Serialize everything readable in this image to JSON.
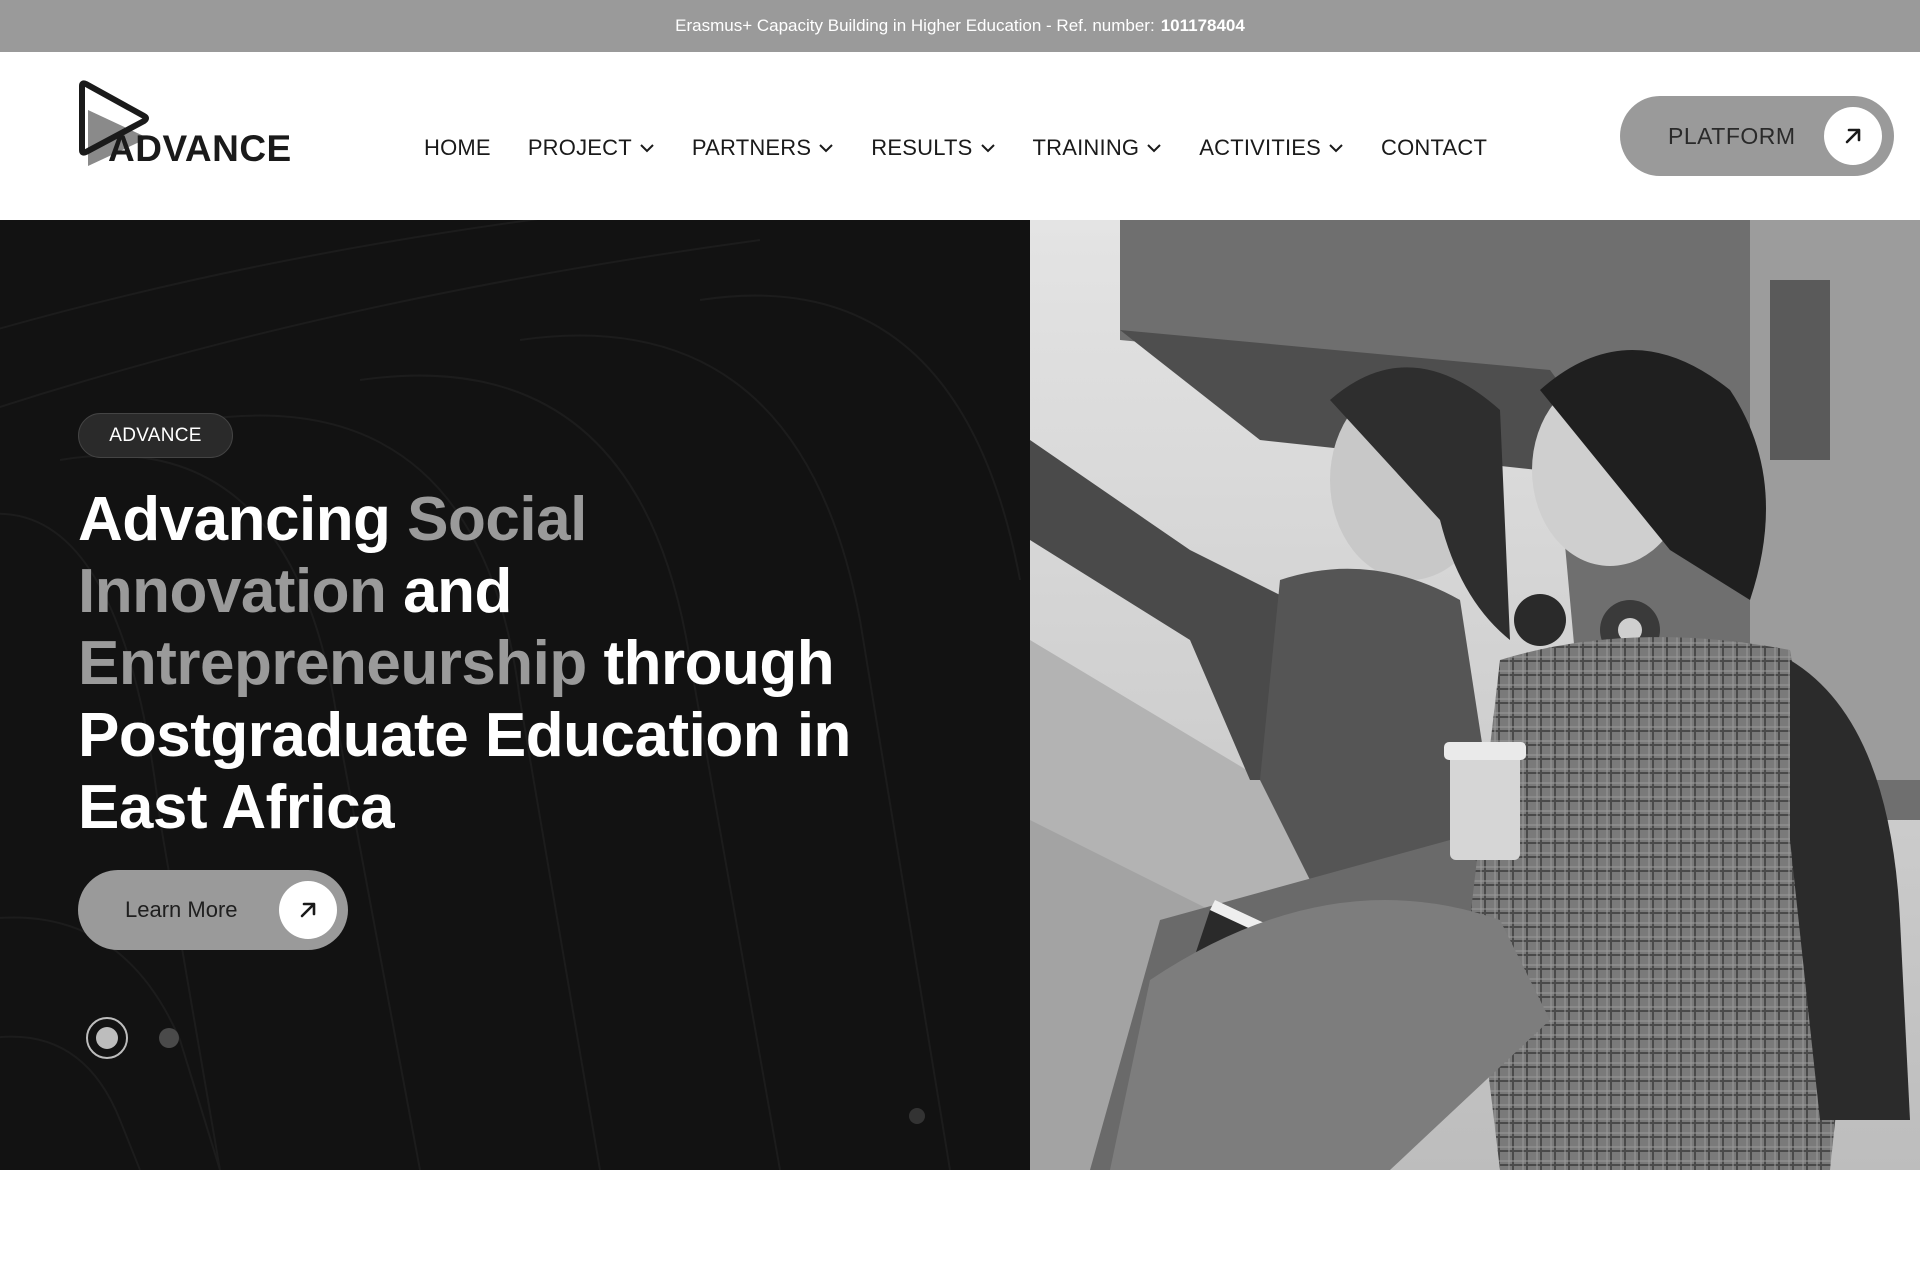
{
  "topbar": {
    "text": "Erasmus+ Capacity Building in Higher Education - Ref. number:",
    "ref_number": "101178404"
  },
  "logo": {
    "text": "ADVANCE",
    "icon": "play-triangle-icon"
  },
  "nav": {
    "items": [
      {
        "label": "HOME",
        "dropdown": false
      },
      {
        "label": "PROJECT",
        "dropdown": true
      },
      {
        "label": "PARTNERS",
        "dropdown": true
      },
      {
        "label": "RESULTS",
        "dropdown": true
      },
      {
        "label": "TRAINING",
        "dropdown": true
      },
      {
        "label": "ACTIVITIES",
        "dropdown": true
      },
      {
        "label": "CONTACT",
        "dropdown": false
      }
    ]
  },
  "platform_button": {
    "label": "PLATFORM",
    "icon": "arrow-up-right-icon"
  },
  "hero": {
    "tag": "ADVANCE",
    "headline": {
      "part1": "Advancing ",
      "part2": "Social Innovation",
      "part3": " and ",
      "part4": "Entrepreneurship",
      "part5": " through Postgraduate Education in East Africa"
    },
    "cta_label": "Learn More",
    "cta_icon": "arrow-up-right-icon",
    "slider": {
      "count": 2,
      "active": 1
    }
  },
  "colors": {
    "topbar_bg": "#9a9a9a",
    "hero_bg": "#121212",
    "accent_grey": "#9a9a9a",
    "text_dark": "#1a1a1a"
  }
}
